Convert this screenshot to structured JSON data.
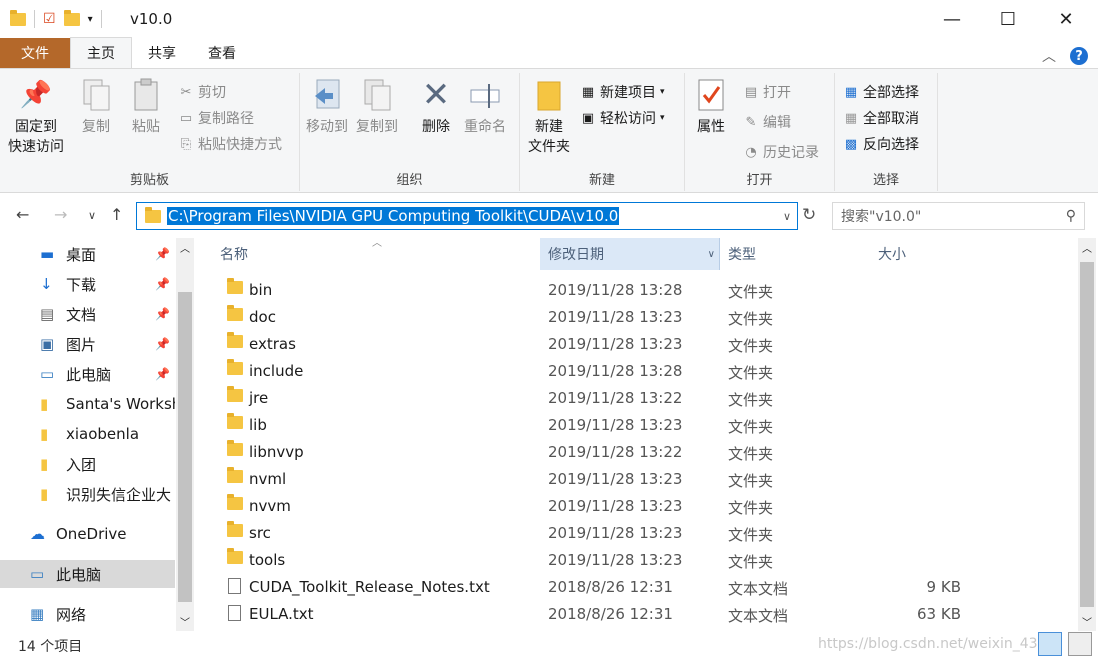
{
  "window": {
    "title": "v10.0",
    "minimize": "—",
    "maximize": "☐",
    "close": "✕"
  },
  "tabs": [
    "文件",
    "主页",
    "共享",
    "查看"
  ],
  "ribbon": {
    "clipboard": {
      "label": "剪贴板",
      "pin_line1": "固定到",
      "pin_line2": "快速访问",
      "copy": "复制",
      "paste": "粘贴",
      "cut": "剪切",
      "copy_path": "复制路径",
      "paste_shortcut": "粘贴快捷方式"
    },
    "organize": {
      "label": "组织",
      "move_to": "移动到",
      "copy_to": "复制到",
      "delete": "删除",
      "rename": "重命名"
    },
    "new": {
      "label": "新建",
      "new_folder_line1": "新建",
      "new_folder_line2": "文件夹",
      "new_item": "新建项目",
      "easy_access": "轻松访问"
    },
    "open": {
      "label": "打开",
      "properties": "属性",
      "open": "打开",
      "edit": "编辑",
      "history": "历史记录"
    },
    "select": {
      "label": "选择",
      "select_all": "全部选择",
      "select_none": "全部取消",
      "invert": "反向选择"
    }
  },
  "address": {
    "path": "C:\\Program Files\\NVIDIA GPU Computing Toolkit\\CUDA\\v10.0",
    "search_placeholder": "搜索\"v10.0\""
  },
  "nav_pane": [
    {
      "label": "桌面",
      "icon": "desktop-icon",
      "pinned": true
    },
    {
      "label": "下载",
      "icon": "download-icon",
      "pinned": true
    },
    {
      "label": "文档",
      "icon": "document-icon",
      "pinned": true
    },
    {
      "label": "图片",
      "icon": "picture-icon",
      "pinned": true
    },
    {
      "label": "此电脑",
      "icon": "computer-icon",
      "pinned": true
    },
    {
      "label": "Santa's Worksh",
      "icon": "folder-icon",
      "pinned": false
    },
    {
      "label": "xiaobenla",
      "icon": "folder-icon",
      "pinned": false
    },
    {
      "label": "入团",
      "icon": "folder-icon",
      "pinned": false
    },
    {
      "label": "识别失信企业大",
      "icon": "folder-icon",
      "pinned": false
    },
    {
      "label": "OneDrive",
      "icon": "cloud-icon",
      "pinned": false
    },
    {
      "label": "此电脑",
      "icon": "computer-icon",
      "pinned": false,
      "selected": true
    },
    {
      "label": "网络",
      "icon": "network-icon",
      "pinned": false
    }
  ],
  "columns": {
    "name": "名称",
    "date": "修改日期",
    "type": "类型",
    "size": "大小"
  },
  "files": [
    {
      "name": "bin",
      "date": "2019/11/28 13:28",
      "type": "文件夹",
      "size": "",
      "kind": "folder"
    },
    {
      "name": "doc",
      "date": "2019/11/28 13:23",
      "type": "文件夹",
      "size": "",
      "kind": "folder"
    },
    {
      "name": "extras",
      "date": "2019/11/28 13:23",
      "type": "文件夹",
      "size": "",
      "kind": "folder"
    },
    {
      "name": "include",
      "date": "2019/11/28 13:28",
      "type": "文件夹",
      "size": "",
      "kind": "folder"
    },
    {
      "name": "jre",
      "date": "2019/11/28 13:22",
      "type": "文件夹",
      "size": "",
      "kind": "folder"
    },
    {
      "name": "lib",
      "date": "2019/11/28 13:23",
      "type": "文件夹",
      "size": "",
      "kind": "folder"
    },
    {
      "name": "libnvvp",
      "date": "2019/11/28 13:22",
      "type": "文件夹",
      "size": "",
      "kind": "folder"
    },
    {
      "name": "nvml",
      "date": "2019/11/28 13:23",
      "type": "文件夹",
      "size": "",
      "kind": "folder"
    },
    {
      "name": "nvvm",
      "date": "2019/11/28 13:23",
      "type": "文件夹",
      "size": "",
      "kind": "folder"
    },
    {
      "name": "src",
      "date": "2019/11/28 13:23",
      "type": "文件夹",
      "size": "",
      "kind": "folder"
    },
    {
      "name": "tools",
      "date": "2019/11/28 13:23",
      "type": "文件夹",
      "size": "",
      "kind": "folder"
    },
    {
      "name": "CUDA_Toolkit_Release_Notes.txt",
      "date": "2018/8/26 12:31",
      "type": "文本文档",
      "size": "9 KB",
      "kind": "text"
    },
    {
      "name": "EULA.txt",
      "date": "2018/8/26 12:31",
      "type": "文本文档",
      "size": "63 KB",
      "kind": "text"
    }
  ],
  "status": {
    "count": "14 个项目",
    "watermark": "https://blog.csdn.net/weixin_43"
  },
  "colors": {
    "file_tab": "#b4682a",
    "accent": "#0078d7",
    "folder": "#f5c542"
  }
}
